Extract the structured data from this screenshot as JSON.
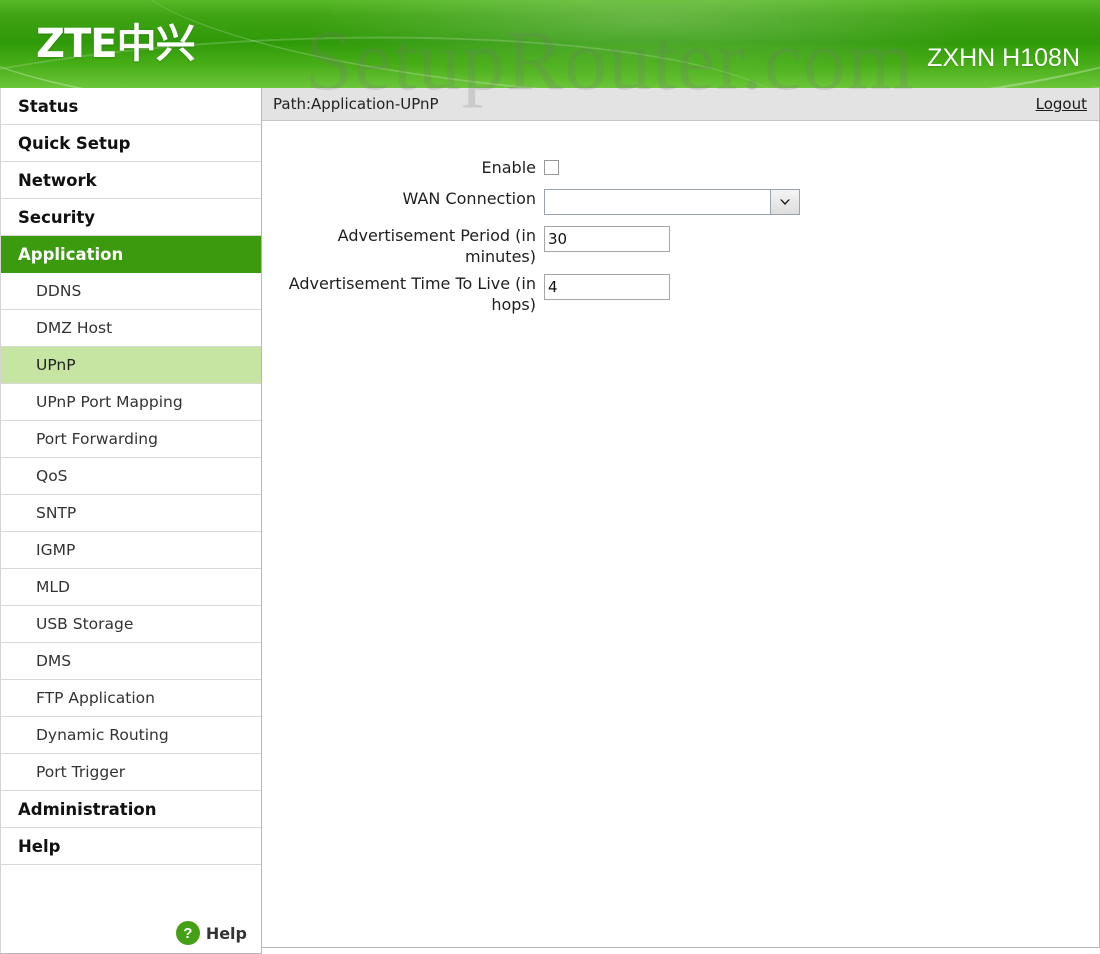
{
  "header": {
    "logo_text": "ZTE中兴",
    "model_name": "ZXHN H108N",
    "watermark": "SetupRouter.com",
    "accent_color": "#3c9a0f",
    "header_gradient_top": "#57b826",
    "header_gradient_mid": "#2f9a09"
  },
  "pathbar": {
    "path_text": "Path:Application-UPnP",
    "logout_label": "Logout"
  },
  "sidebar": {
    "items": [
      {
        "label": "Status",
        "type": "top",
        "state": "normal"
      },
      {
        "label": "Quick Setup",
        "type": "top",
        "state": "normal"
      },
      {
        "label": "Network",
        "type": "top",
        "state": "normal"
      },
      {
        "label": "Security",
        "type": "top",
        "state": "normal"
      },
      {
        "label": "Application",
        "type": "top",
        "state": "active"
      },
      {
        "label": "DDNS",
        "type": "sub",
        "state": "normal"
      },
      {
        "label": "DMZ Host",
        "type": "sub",
        "state": "normal"
      },
      {
        "label": "UPnP",
        "type": "sub",
        "state": "active"
      },
      {
        "label": "UPnP Port Mapping",
        "type": "sub",
        "state": "normal"
      },
      {
        "label": "Port Forwarding",
        "type": "sub",
        "state": "normal"
      },
      {
        "label": "QoS",
        "type": "sub",
        "state": "normal"
      },
      {
        "label": "SNTP",
        "type": "sub",
        "state": "normal"
      },
      {
        "label": "IGMP",
        "type": "sub",
        "state": "normal"
      },
      {
        "label": "MLD",
        "type": "sub",
        "state": "normal"
      },
      {
        "label": "USB Storage",
        "type": "sub",
        "state": "normal"
      },
      {
        "label": "DMS",
        "type": "sub",
        "state": "normal"
      },
      {
        "label": "FTP Application",
        "type": "sub",
        "state": "normal"
      },
      {
        "label": "Dynamic Routing",
        "type": "sub",
        "state": "normal"
      },
      {
        "label": "Port Trigger",
        "type": "sub",
        "state": "normal"
      },
      {
        "label": "Administration",
        "type": "top",
        "state": "normal"
      },
      {
        "label": "Help",
        "type": "top",
        "state": "normal"
      }
    ],
    "help_badge": {
      "icon": "question-mark-icon",
      "glyph": "?",
      "label": "Help",
      "color": "#45a016"
    },
    "active_top_bg": "#3c9a0f",
    "active_sub_bg": "#c6e5a2"
  },
  "form": {
    "enable": {
      "label": "Enable",
      "checked": false
    },
    "wan_connection": {
      "label": "WAN Connection",
      "value": "",
      "options": []
    },
    "advertisement_period": {
      "label": "Advertisement Period (in minutes)",
      "value": "30"
    },
    "advertisement_ttl": {
      "label": "Advertisement Time To Live (in hops)",
      "value": "4"
    }
  }
}
